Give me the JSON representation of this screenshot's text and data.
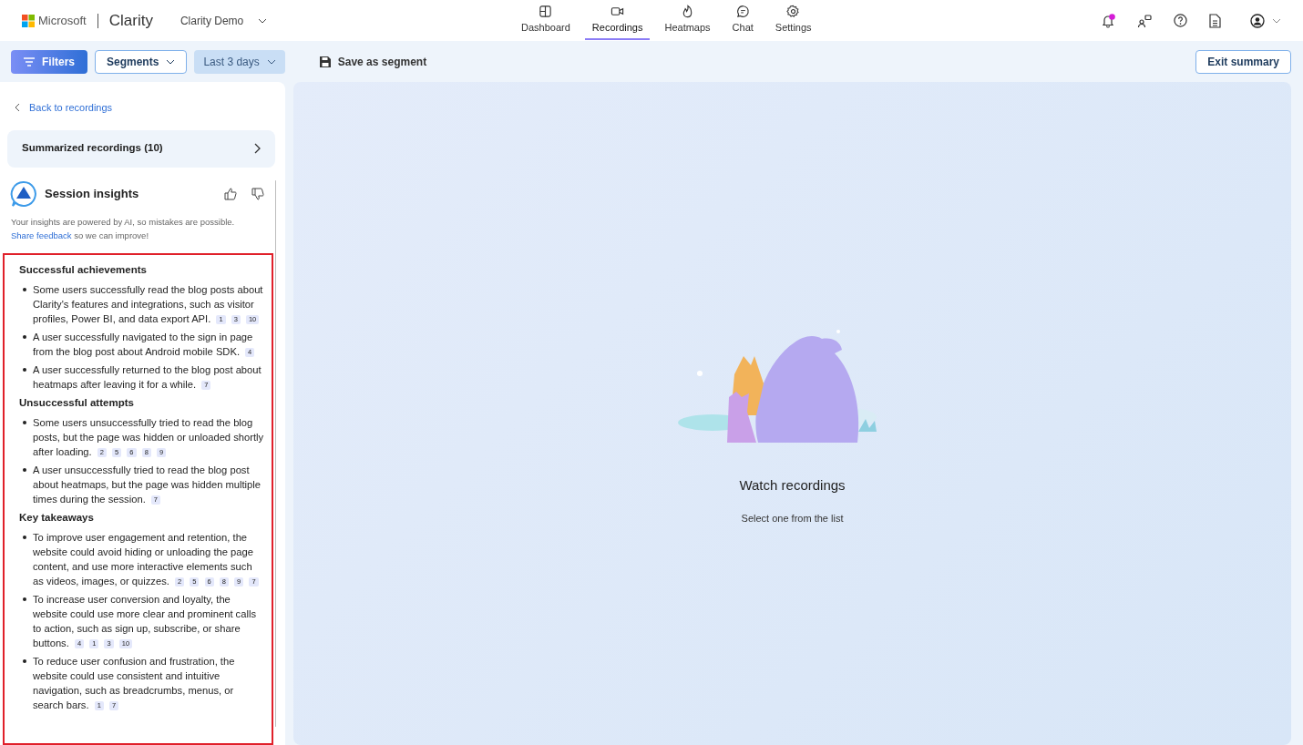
{
  "header": {
    "brand": "Microsoft",
    "product": "Clarity",
    "project": "Clarity Demo",
    "nav": [
      {
        "label": "Dashboard",
        "selected": false
      },
      {
        "label": "Recordings",
        "selected": true
      },
      {
        "label": "Heatmaps",
        "selected": false
      },
      {
        "label": "Chat",
        "selected": false
      },
      {
        "label": "Settings",
        "selected": false
      }
    ],
    "notifications_unread": true
  },
  "toolbar": {
    "filters": "Filters",
    "segments": "Segments",
    "date_range": "Last 3 days",
    "save": "Save as segment",
    "exit": "Exit summary"
  },
  "sidebar": {
    "back": "Back to recordings",
    "summarized": "Summarized recordings (10)",
    "insights": {
      "title": "Session insights",
      "disclaimer": "Your insights are powered by AI, so mistakes are possible.",
      "feedback_link": "Share feedback",
      "feedback_rest": " so we can improve!",
      "highlighted": true,
      "sections": [
        {
          "title": "Successful achievements",
          "items": [
            {
              "text": "Some users successfully read the blog posts about Clarity's features and integrations, such as visitor profiles, Power BI, and data export API.",
              "citations": [
                "1",
                "3",
                "10"
              ]
            },
            {
              "text": "A user successfully navigated to the sign in page from the blog post about Android mobile SDK.",
              "citations": [
                "4"
              ]
            },
            {
              "text": "A user successfully returned to the blog post about heatmaps after leaving it for a while.",
              "citations": [
                "7"
              ]
            }
          ]
        },
        {
          "title": "Unsuccessful attempts",
          "items": [
            {
              "text": "Some users unsuccessfully tried to read the blog posts, but the page was hidden or unloaded shortly after loading.",
              "citations": [
                "2",
                "5",
                "6",
                "8",
                "9"
              ]
            },
            {
              "text": "A user unsuccessfully tried to read the blog post about heatmaps, but the page was hidden multiple times during the session.",
              "citations": [
                "7"
              ]
            }
          ]
        },
        {
          "title": "Key takeaways",
          "items": [
            {
              "text": "To improve user engagement and retention, the website could avoid hiding or unloading the page content, and use more interactive elements such as videos, images, or quizzes.",
              "citations": [
                "2",
                "5",
                "6",
                "8",
                "9",
                "7"
              ]
            },
            {
              "text": "To increase user conversion and loyalty, the website could use more clear and prominent calls to action, such as sign up, subscribe, or share buttons.",
              "citations": [
                "4",
                "1",
                "3",
                "10"
              ]
            },
            {
              "text": "To reduce user confusion and frustration, the website could use consistent and intuitive navigation, such as breadcrumbs, menus, or search bars.",
              "citations": [
                "1",
                "7"
              ]
            }
          ]
        }
      ]
    }
  },
  "main": {
    "title": "Watch recordings",
    "subtitle": "Select one from the list"
  }
}
